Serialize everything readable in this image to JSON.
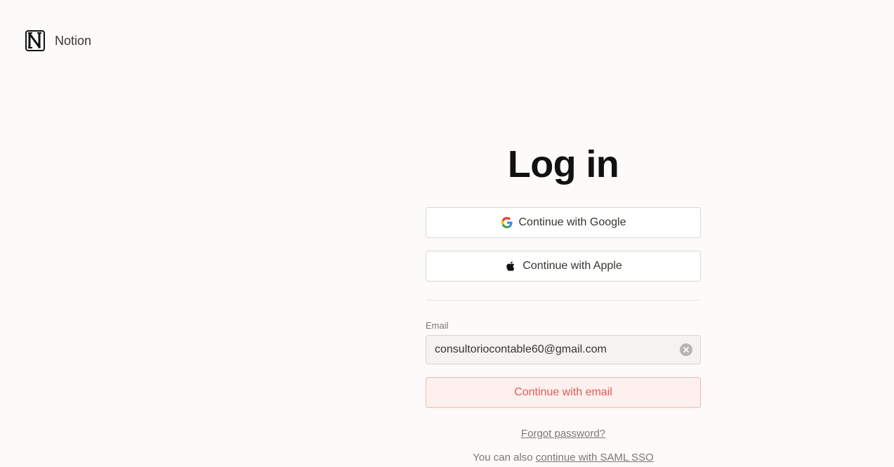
{
  "brand": {
    "logo_icon": "notion-logo-icon",
    "name": "Notion"
  },
  "login": {
    "title": "Log in",
    "google_button": {
      "icon": "google-icon",
      "label": "Continue with Google"
    },
    "apple_button": {
      "icon": "apple-icon",
      "label": "Continue with Apple"
    },
    "email_label": "Email",
    "email_value": "consultoriocontable60@gmail.com",
    "clear_icon": "clear-icon",
    "email_button_label": "Continue with email",
    "forgot_password": "Forgot password?",
    "saml_prefix": "You can also ",
    "saml_link": "continue with SAML SSO"
  },
  "colors": {
    "page_background": "#fcfbfa",
    "text_primary": "#37352f",
    "text_secondary": "#7a7773",
    "accent_red": "#e05b57",
    "email_button_bg": "#fdf0ee"
  }
}
